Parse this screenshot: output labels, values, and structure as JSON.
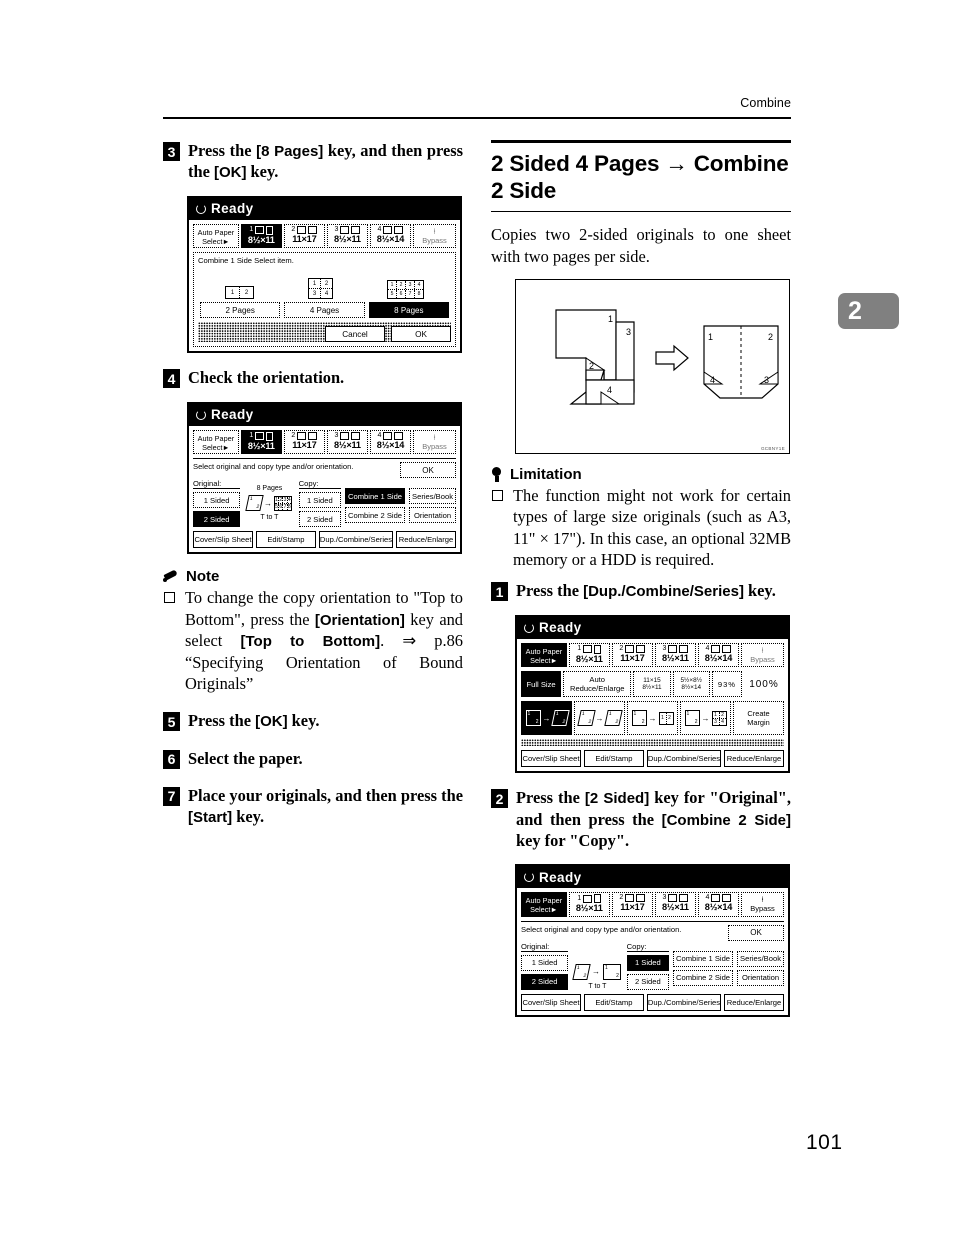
{
  "header": {
    "running_head": "Combine"
  },
  "chapter_tab": {
    "number": "2"
  },
  "page_number": "101",
  "left_column": {
    "steps": [
      {
        "num": "3",
        "text_html": "Press the <b>[8 Pages]</b> key, and then press the <b>[OK]</b> key."
      },
      {
        "num": "4",
        "text_html": "Check the orientation."
      },
      {
        "num": "5",
        "text_html": "Press the <b>[OK]</b> key."
      },
      {
        "num": "6",
        "text_html": "Select the paper."
      },
      {
        "num": "7",
        "text_html": "Place your originals, and then press the <b>[Start]</b> key."
      }
    ],
    "note": {
      "icon": "pencil-icon",
      "heading": "Note",
      "items_html": [
        "To change the copy orientation to \"Top to Bottom\", press the <b>[Orientation]</b> key and select <b>[Top to Bottom]</b>. ⇒ p.86 “Specifying Orientation of Bound Originals”"
      ]
    }
  },
  "right_column": {
    "section": {
      "title": "2 Sided 4 Pages → Combine 2 Side",
      "intro": "Copies two 2-sided originals to one sheet with two pages per side."
    },
    "illustration": {
      "code": "GCBNY1E",
      "original_pages": [
        "1",
        "3",
        "2",
        "4"
      ],
      "result_pages": [
        "1",
        "2",
        "4",
        "3"
      ]
    },
    "limitation": {
      "icon": "bulb-icon",
      "heading": "Limitation",
      "items_html": [
        "The function might not work for certain types of large size originals (such as A3, 11\" × 17\"). In this case, an optional 32MB memory or a HDD is required."
      ]
    },
    "steps": [
      {
        "num": "1",
        "text_html": "Press the <b>[Dup./Combine/Series]</b> key."
      },
      {
        "num": "2",
        "text_html": "Press the <b>[2 Sided]</b> key for \"Original\", and then press the <b>[Combine 2 Side]</b> key for \"Copy\"."
      }
    ]
  },
  "lcd_common": {
    "status": "Ready",
    "paper_row": {
      "auto_label_line1": "Auto Paper",
      "auto_label_line2": "Select",
      "trays": [
        {
          "num": "1",
          "size": "8½×11",
          "selected": true
        },
        {
          "num": "2",
          "size": "11×17",
          "selected": false
        },
        {
          "num": "3",
          "size": "8½×11",
          "selected": false
        },
        {
          "num": "4",
          "size": "8½×14",
          "selected": false
        }
      ],
      "bypass_label": "Bypass"
    },
    "bottom_tabs": [
      "Cover/Slip Sheet",
      "Edit/Stamp",
      "Dup./Combine/Series",
      "Reduce/Enlarge"
    ]
  },
  "lcd_combine_select": {
    "prompt": "Combine 1 Side    Select item.",
    "page_buttons": [
      {
        "label": "2 Pages",
        "selected": false
      },
      {
        "label": "4 Pages",
        "selected": false
      },
      {
        "label": "8 Pages",
        "selected": true
      }
    ],
    "thumb_2": [
      "1",
      "2"
    ],
    "thumb_4": [
      "1",
      "2",
      "3",
      "4"
    ],
    "thumb_8": [
      "1",
      "2",
      "3",
      "4",
      "5",
      "6",
      "7",
      "8"
    ],
    "cancel_label": "Cancel",
    "ok_label": "OK"
  },
  "lcd_orientation": {
    "prompt": "Select original and copy type and/or orientation.",
    "ok_label": "OK",
    "original_label": "Original:",
    "copy_label": "Copy:",
    "pages_caption": "8 Pages",
    "orient_caption": "T to T",
    "original_buttons": [
      {
        "label": "1 Sided",
        "selected": false
      },
      {
        "label": "2 Sided",
        "selected": true
      }
    ],
    "copy_buttons_col1": [
      {
        "label": "1 Sided",
        "selected": false
      },
      {
        "label": "2 Sided",
        "selected": false
      }
    ],
    "copy_buttons_col2": [
      {
        "label": "Combine 1 Side",
        "selected": true
      },
      {
        "label": "Combine 2 Side",
        "selected": false
      }
    ],
    "side_buttons": [
      "Series/Book",
      "Orientation"
    ]
  },
  "lcd_main": {
    "zoom_row": {
      "full_size": {
        "label": "Full Size",
        "selected": true
      },
      "auto_rte": "Auto Reduce/Enlarge",
      "preset1_top": "11×15",
      "preset1_bot": "8½×11",
      "preset2_top": "5½×8½",
      "preset2_bot": "8½×14",
      "preset3": "93%",
      "current_ratio": "100%"
    },
    "duplex_row": {
      "buttons": [
        {
          "id": "1to2",
          "selected": true
        },
        {
          "id": "2to2",
          "selected": false
        },
        {
          "id": "1to1combine2",
          "selected": false
        },
        {
          "id": "1to1combine4",
          "selected": false
        }
      ],
      "create_margin_line1": "Create",
      "create_margin_line2": "Margin"
    }
  },
  "lcd_orientation_2": {
    "prompt": "Select original and copy type and/or orientation.",
    "ok_label": "OK",
    "original_label": "Original:",
    "copy_label": "Copy:",
    "orient_caption": "T to T",
    "original_buttons": [
      {
        "label": "1 Sided",
        "selected": false
      },
      {
        "label": "2 Sided",
        "selected": true
      }
    ],
    "copy_buttons_col1": [
      {
        "label": "1 Sided",
        "selected": true
      },
      {
        "label": "2 Sided",
        "selected": false
      }
    ],
    "copy_buttons_col2": [
      {
        "label": "Combine 1 Side",
        "selected": false
      },
      {
        "label": "Combine 2 Side",
        "selected": false
      }
    ],
    "side_buttons": [
      "Series/Book",
      "Orientation"
    ]
  }
}
